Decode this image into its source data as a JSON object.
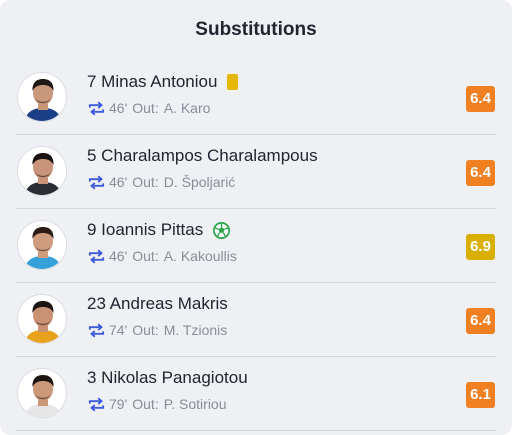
{
  "panel": {
    "title": "Substitutions"
  },
  "colors": {
    "rating_orange": "#f08022",
    "rating_yellow": "#d9af00",
    "swap_icon": "#3c5bdc",
    "yellow_card": "#e6b707",
    "goal_icon": "#2aa24a"
  },
  "substitutions": [
    {
      "player": "7 Minas Antoniou",
      "minute": "46'",
      "out_label": "Out:",
      "out_player": "A. Karo",
      "rating": "6.4",
      "rating_color": "#f08022",
      "event": "yellow-card",
      "kit": "#1b3f86",
      "skin": "#c9977a",
      "hair": "#1e1714"
    },
    {
      "player": "5 Charalampos Charalampous",
      "minute": "46'",
      "out_label": "Out:",
      "out_player": "D. Špoljarić",
      "rating": "6.4",
      "rating_color": "#f08022",
      "event": "none",
      "kit": "#2a2d33",
      "skin": "#c99479",
      "hair": "#181210"
    },
    {
      "player": "9 Ioannis Pittas",
      "minute": "46'",
      "out_label": "Out:",
      "out_player": "A. Kakoullis",
      "rating": "6.9",
      "rating_color": "#d9af00",
      "event": "goal",
      "kit": "#36a0d8",
      "skin": "#cf9c7e",
      "hair": "#2b1d15"
    },
    {
      "player": "23 Andreas Makris",
      "minute": "74'",
      "out_label": "Out:",
      "out_player": "M. Tzionis",
      "rating": "6.4",
      "rating_color": "#f08022",
      "event": "none",
      "kit": "#e8a21e",
      "skin": "#c99274",
      "hair": "#1b1410"
    },
    {
      "player": "3 Nikolas Panagiotou",
      "minute": "79'",
      "out_label": "Out:",
      "out_player": "P. Sotiriou",
      "rating": "6.1",
      "rating_color": "#f08022",
      "event": "none",
      "kit": "#e6e6e6",
      "skin": "#cb987a",
      "hair": "#1c1512"
    }
  ]
}
